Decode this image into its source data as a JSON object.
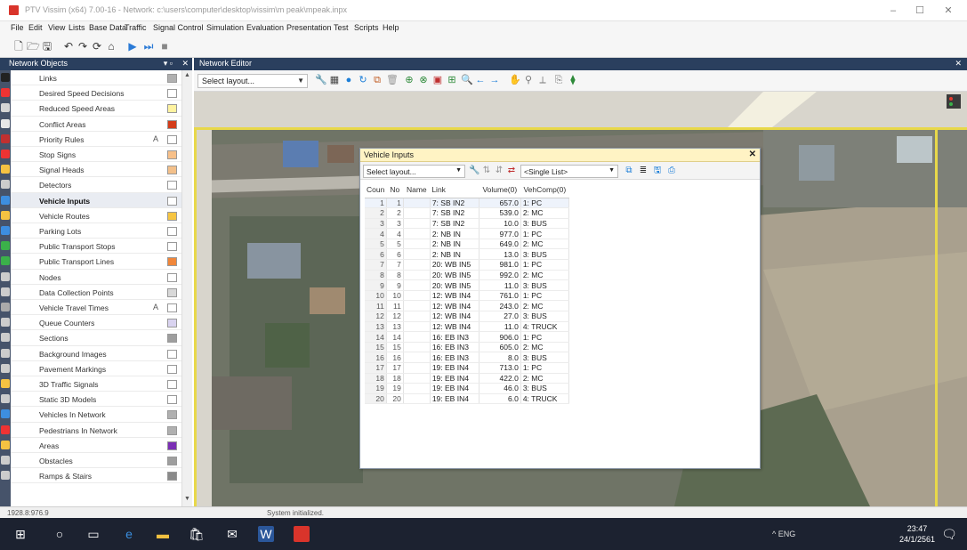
{
  "window": {
    "title": "PTV Vissim (x64) 7.00-16 - Network: c:\\users\\computer\\desktop\\vissim\\m peak\\mpeak.inpx",
    "minimize": "–",
    "maximize": "☐",
    "close": "✕"
  },
  "menubar": [
    "File",
    "Edit",
    "View",
    "Lists",
    "Base Data",
    "Traffic",
    "Signal Control",
    "Simulation",
    "Evaluation",
    "Presentation",
    "Test",
    "Scripts",
    "Help"
  ],
  "network_objects": {
    "title": "Network Objects",
    "pin": "▾ ▫",
    "close": "✕",
    "items": [
      {
        "label": "Links",
        "letter": "",
        "swatch": "#b0b0b0"
      },
      {
        "label": "Desired Speed Decisions",
        "letter": "",
        "swatch": "#ffffff"
      },
      {
        "label": "Reduced Speed Areas",
        "letter": "",
        "swatch": "#fff3a0"
      },
      {
        "label": "Conflict Areas",
        "letter": "",
        "swatch": "#d33c1a"
      },
      {
        "label": "Priority Rules",
        "letter": "A",
        "swatch": "#ffffff"
      },
      {
        "label": "Stop Signs",
        "letter": "",
        "swatch": "#f7c089"
      },
      {
        "label": "Signal Heads",
        "letter": "",
        "swatch": "#f3c08a"
      },
      {
        "label": "Detectors",
        "letter": "",
        "swatch": "#ffffff"
      },
      {
        "label": "Vehicle Inputs",
        "letter": "",
        "swatch": "#ffffff"
      },
      {
        "label": "Vehicle Routes",
        "letter": "",
        "swatch": "#f6c542"
      },
      {
        "label": "Parking Lots",
        "letter": "",
        "swatch": "#ffffff"
      },
      {
        "label": "Public Transport Stops",
        "letter": "",
        "swatch": "#ffffff"
      },
      {
        "label": "Public Transport Lines",
        "letter": "",
        "swatch": "#f0863a"
      },
      {
        "label": "Nodes",
        "letter": "",
        "swatch": "#ffffff"
      },
      {
        "label": "Data Collection Points",
        "letter": "",
        "swatch": "#d8d8d8"
      },
      {
        "label": "Vehicle Travel Times",
        "letter": "A",
        "swatch": "#ffffff"
      },
      {
        "label": "Queue Counters",
        "letter": "",
        "swatch": "#d9d3f0"
      },
      {
        "label": "Sections",
        "letter": "",
        "swatch": "#9e9e9e"
      },
      {
        "label": "Background Images",
        "letter": "",
        "swatch": "#ffffff"
      },
      {
        "label": "Pavement Markings",
        "letter": "",
        "swatch": "#ffffff"
      },
      {
        "label": "3D Traffic Signals",
        "letter": "",
        "swatch": "#ffffff"
      },
      {
        "label": "Static 3D Models",
        "letter": "",
        "swatch": "#ffffff"
      },
      {
        "label": "Vehicles In Network",
        "letter": "",
        "swatch": "#b0b0b0"
      },
      {
        "label": "Pedestrians In Network",
        "letter": "",
        "swatch": "#b0b0b0"
      },
      {
        "label": "Areas",
        "letter": "",
        "swatch": "#7b2fb5"
      },
      {
        "label": "Obstacles",
        "letter": "",
        "swatch": "#9e9e9e"
      },
      {
        "label": "Ramps & Stairs",
        "letter": "",
        "swatch": "#8a8a8a"
      }
    ],
    "active_item": "Vehicle Inputs"
  },
  "network_editor": {
    "title": "Network Editor",
    "close": "✕",
    "layout_select": "Select layout..."
  },
  "vehicle_inputs": {
    "title": "Vehicle Inputs",
    "close": "✕",
    "layout_select": "Select layout...",
    "list_select": "<Single List>",
    "columns": [
      "Coun",
      "No",
      "Name",
      "Link",
      "Volume(0)",
      "VehComp(0)"
    ],
    "rows": [
      {
        "count": "1",
        "no": "1",
        "name": "",
        "link": "7: SB IN2",
        "volume": "657.0",
        "vehcomp": "1: PC"
      },
      {
        "count": "2",
        "no": "2",
        "name": "",
        "link": "7: SB IN2",
        "volume": "539.0",
        "vehcomp": "2: MC"
      },
      {
        "count": "3",
        "no": "3",
        "name": "",
        "link": "7: SB IN2",
        "volume": "10.0",
        "vehcomp": "3: BUS"
      },
      {
        "count": "4",
        "no": "4",
        "name": "",
        "link": "2: NB IN",
        "volume": "977.0",
        "vehcomp": "1: PC"
      },
      {
        "count": "5",
        "no": "5",
        "name": "",
        "link": "2: NB IN",
        "volume": "649.0",
        "vehcomp": "2: MC"
      },
      {
        "count": "6",
        "no": "6",
        "name": "",
        "link": "2: NB IN",
        "volume": "13.0",
        "vehcomp": "3: BUS"
      },
      {
        "count": "7",
        "no": "7",
        "name": "",
        "link": "20: WB IN5",
        "volume": "981.0",
        "vehcomp": "1: PC"
      },
      {
        "count": "8",
        "no": "8",
        "name": "",
        "link": "20: WB IN5",
        "volume": "992.0",
        "vehcomp": "2: MC"
      },
      {
        "count": "9",
        "no": "9",
        "name": "",
        "link": "20: WB IN5",
        "volume": "11.0",
        "vehcomp": "3: BUS"
      },
      {
        "count": "10",
        "no": "10",
        "name": "",
        "link": "12: WB IN4",
        "volume": "761.0",
        "vehcomp": "1: PC"
      },
      {
        "count": "11",
        "no": "11",
        "name": "",
        "link": "12: WB IN4",
        "volume": "243.0",
        "vehcomp": "2: MC"
      },
      {
        "count": "12",
        "no": "12",
        "name": "",
        "link": "12: WB IN4",
        "volume": "27.0",
        "vehcomp": "3: BUS"
      },
      {
        "count": "13",
        "no": "13",
        "name": "",
        "link": "12: WB IN4",
        "volume": "11.0",
        "vehcomp": "4: TRUCK"
      },
      {
        "count": "14",
        "no": "14",
        "name": "",
        "link": "16: EB IN3",
        "volume": "906.0",
        "vehcomp": "1: PC"
      },
      {
        "count": "15",
        "no": "15",
        "name": "",
        "link": "16: EB IN3",
        "volume": "605.0",
        "vehcomp": "2: MC"
      },
      {
        "count": "16",
        "no": "16",
        "name": "",
        "link": "16: EB IN3",
        "volume": "8.0",
        "vehcomp": "3: BUS"
      },
      {
        "count": "17",
        "no": "17",
        "name": "",
        "link": "19: EB IN4",
        "volume": "713.0",
        "vehcomp": "1: PC"
      },
      {
        "count": "18",
        "no": "18",
        "name": "",
        "link": "19: EB IN4",
        "volume": "422.0",
        "vehcomp": "2: MC"
      },
      {
        "count": "19",
        "no": "19",
        "name": "",
        "link": "19: EB IN4",
        "volume": "46.0",
        "vehcomp": "3: BUS"
      },
      {
        "count": "20",
        "no": "20",
        "name": "",
        "link": "19: EB IN4",
        "volume": "6.0",
        "vehcomp": "4: TRUCK"
      }
    ]
  },
  "statusbar": {
    "coords": "1928.8:976.9",
    "message": "System initialized."
  },
  "taskbar": {
    "tray_text": "^ ENG",
    "time": "23:47",
    "date": "24/1/2561"
  },
  "colors": {
    "panel_header": "#2a3f5e",
    "window_title": "#fff3c4",
    "taskbar": "#1c2230"
  }
}
